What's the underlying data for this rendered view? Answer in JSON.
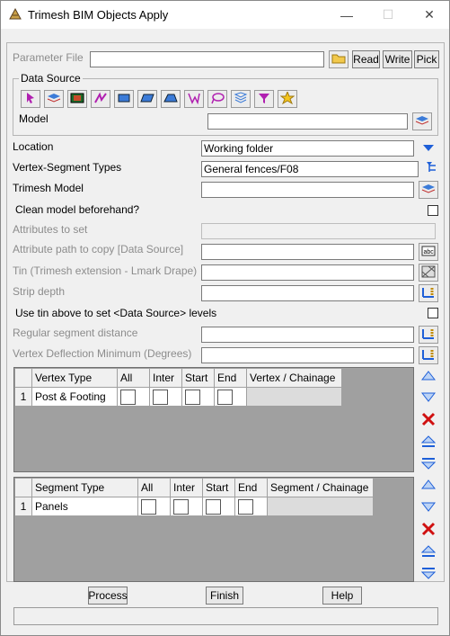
{
  "window": {
    "title": "Trimesh BIM Objects Apply",
    "minimize": "—",
    "maximize": "☐",
    "close": "✕"
  },
  "parameter_file": {
    "label": "Parameter File",
    "value": "",
    "read": "Read",
    "write": "Write",
    "pick": "Pick"
  },
  "data_source": {
    "label": "Data Source",
    "model_label": "Model",
    "model_value": ""
  },
  "fields": {
    "location_label": "Location",
    "location_value": "Working folder",
    "vs_types_label": "Vertex-Segment Types",
    "vs_types_value": "General fences/F08",
    "trimesh_model_label": "Trimesh Model",
    "trimesh_model_value": "",
    "clean_label": "Clean model beforehand?",
    "attributes_label": "Attributes to set",
    "attr_path_label": "Attribute path to copy [Data Source]",
    "tin_label": "Tin (Trimesh extension - Lmark Drape)",
    "strip_label": "Strip depth",
    "use_tin_label": "Use tin above to set <Data Source> levels",
    "reg_seg_label": "Regular segment distance",
    "vdm_label": "Vertex Deflection Minimum (Degrees)"
  },
  "vertex_grid": {
    "columns": [
      "Vertex Type",
      "All",
      "Inter",
      "Start",
      "End",
      "Vertex / Chainage"
    ],
    "rows": [
      {
        "num": "1",
        "type": "Post & Footing"
      }
    ]
  },
  "segment_grid": {
    "columns": [
      "Segment Type",
      "All",
      "Inter",
      "Start",
      "End",
      "Segment / Chainage"
    ],
    "rows": [
      {
        "num": "1",
        "type": "Panels"
      }
    ]
  },
  "buttons": {
    "process": "Process",
    "finish": "Finish",
    "help": "Help"
  },
  "colors": {
    "grid_bg": "#a0a0a0",
    "arrow_blue": "#1e5fd8",
    "delete_red": "#d01010"
  }
}
